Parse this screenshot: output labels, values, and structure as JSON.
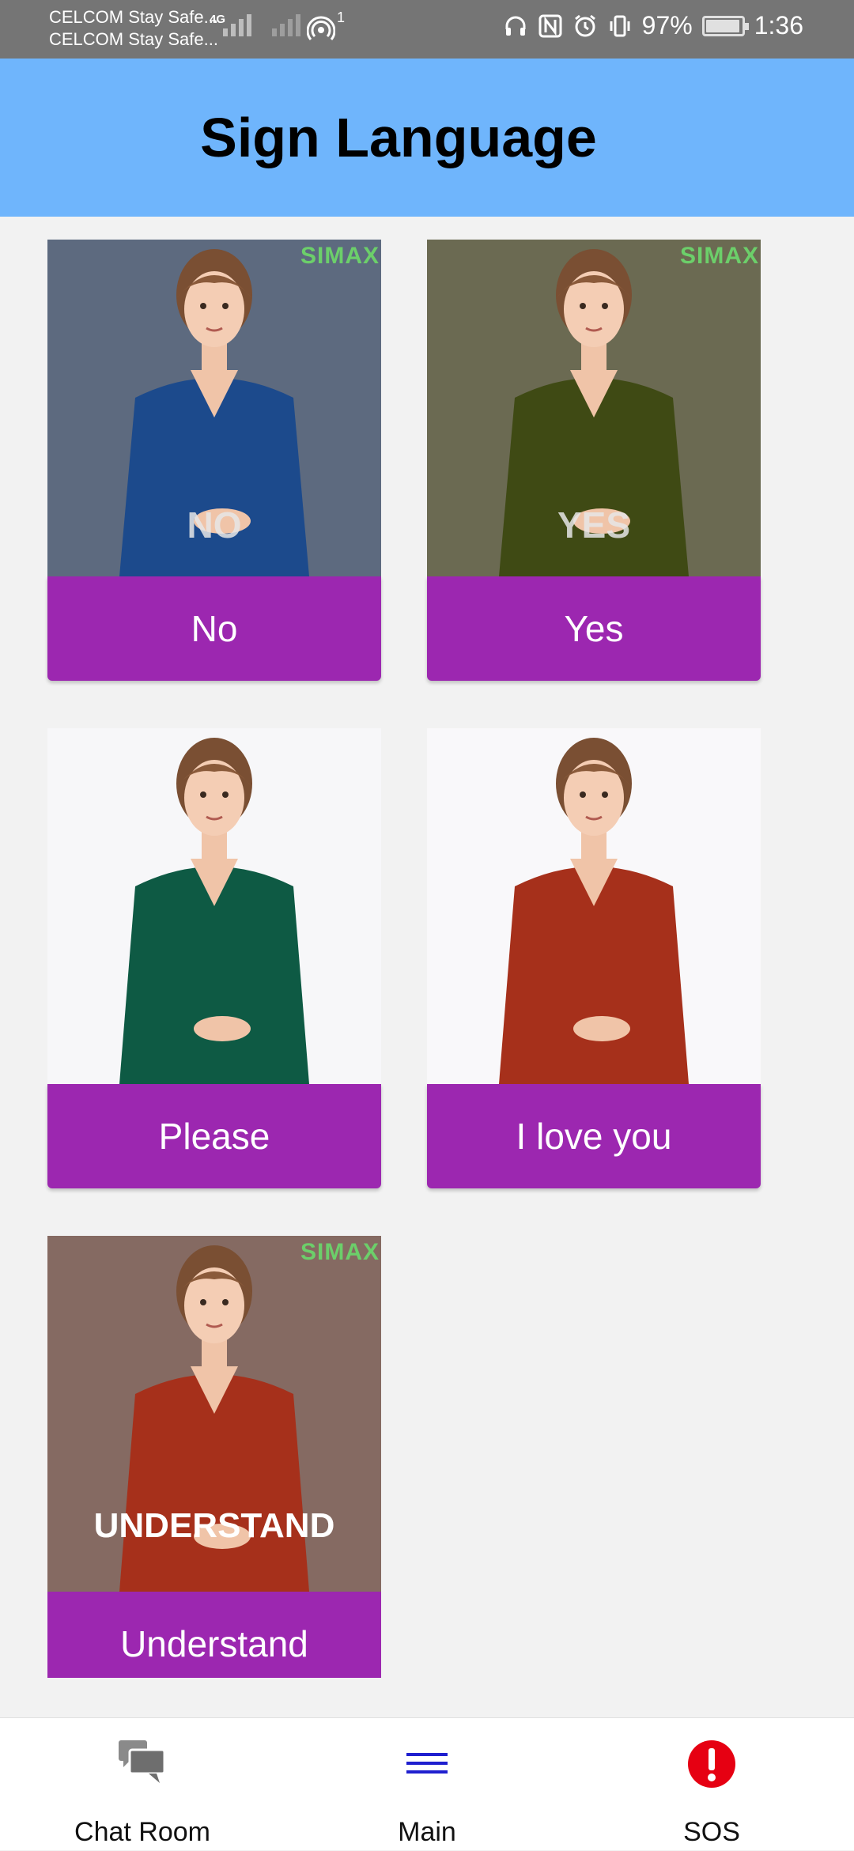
{
  "status_bar": {
    "carrier_1": "CELCOM Stay Safe...",
    "carrier_2": "CELCOM Stay Safe...",
    "network_type": "4G",
    "hotspot_count": "1",
    "battery_percent": "97%",
    "battery_level": 0.97,
    "time": "1:36"
  },
  "header": {
    "title": "Sign Language"
  },
  "cards": [
    {
      "label": "No",
      "caption": "NO",
      "watermark": "SIMAX",
      "bg": "#5d6a7f",
      "shirt": "#1c4a8c"
    },
    {
      "label": "Yes",
      "caption": "YES",
      "watermark": "SIMAX",
      "bg": "#6b6a52",
      "shirt": "#3f4a14"
    },
    {
      "label": "Please",
      "caption": "",
      "watermark": "",
      "bg": "#f7f7f9",
      "shirt": "#0e5a44"
    },
    {
      "label": "I love you",
      "caption": "",
      "watermark": "",
      "bg": "#f9f8fa",
      "shirt": "#a6301b"
    },
    {
      "label": "Understand",
      "caption": "UNDERSTAND",
      "watermark": "SIMAX",
      "bg": "#856a62",
      "shirt": "#a6301b"
    }
  ],
  "bottom_nav": {
    "chat_room": "Chat Room",
    "main": "Main",
    "sos": "SOS"
  },
  "colors": {
    "header_bg": "#6fb5fc",
    "button_bg": "#9c27b0",
    "sos_red": "#e60012",
    "main_icon_blue": "#1f1fcf"
  }
}
